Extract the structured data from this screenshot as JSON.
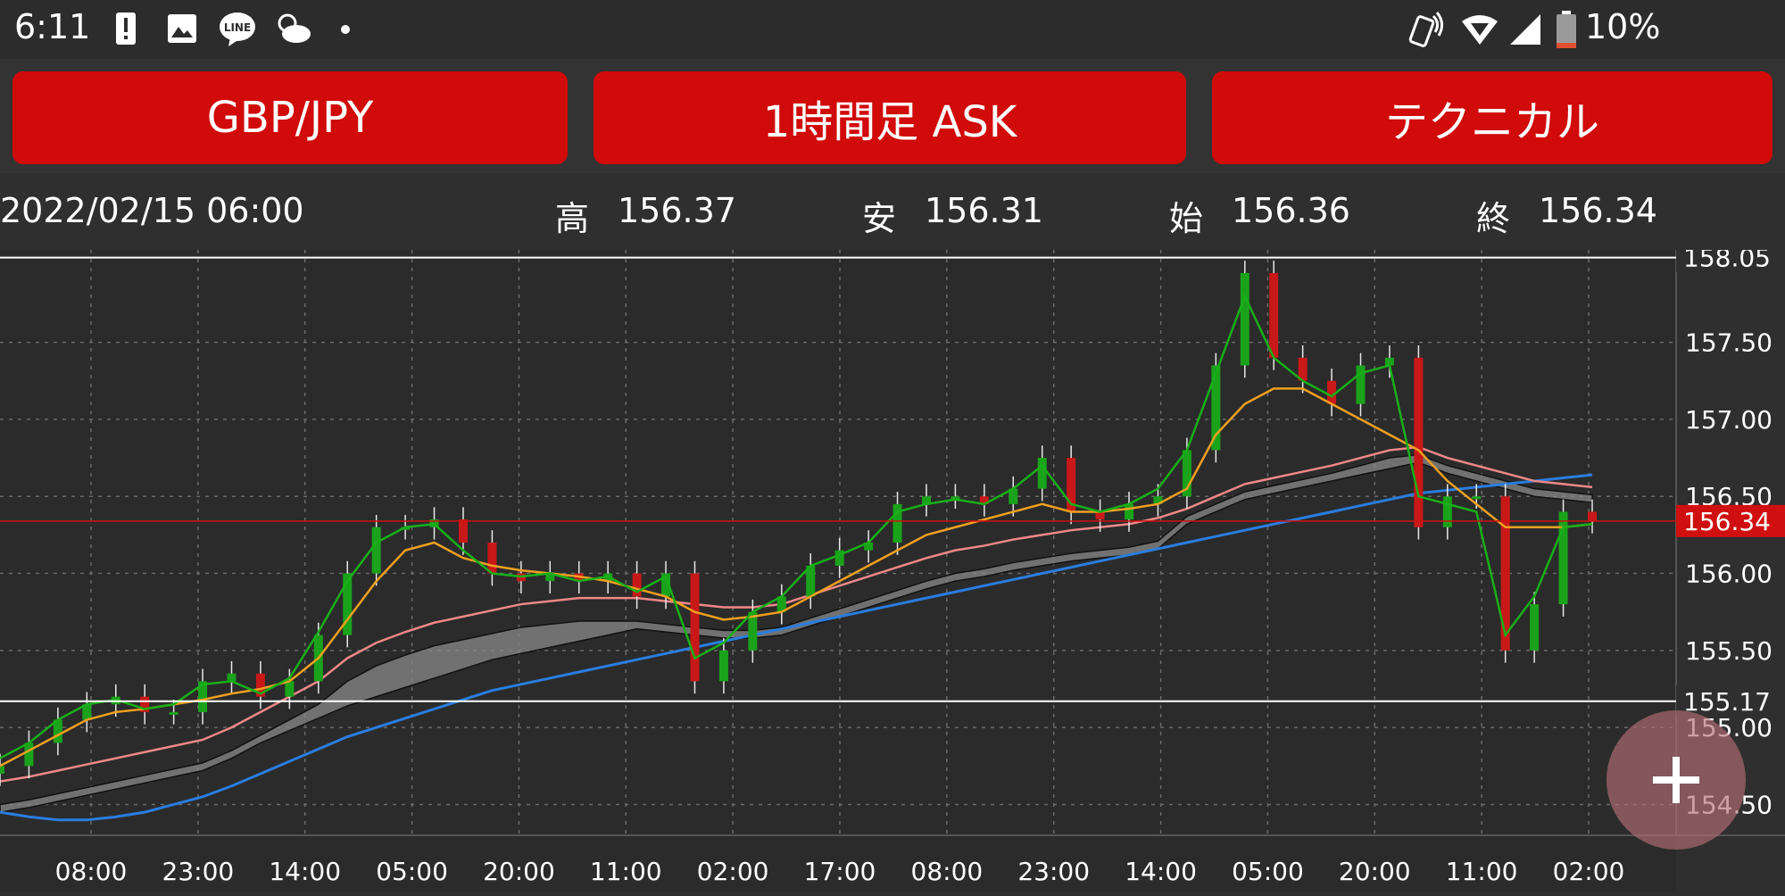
{
  "status_bar": {
    "time": "6:11",
    "battery": "10%",
    "icons": [
      "alert-icon",
      "image-icon",
      "line-app-icon",
      "weather-icon",
      "dot-icon",
      "phone-vibrate-icon",
      "wifi-icon",
      "signal-icon",
      "battery-icon"
    ],
    "line_label": "LINE"
  },
  "buttons": {
    "pair": "GBP/JPY",
    "timeframe": "1時間足 ASK",
    "technical": "テクニカル"
  },
  "info": {
    "datetime": "2022/02/15 06:00",
    "high_label": "高",
    "high": "156.37",
    "low_label": "安",
    "low": "156.31",
    "open_label": "始",
    "open": "156.36",
    "close_label": "終",
    "close": "156.34"
  },
  "colors": {
    "button_red": "#d10a0a",
    "up_candle": "#1aa31a",
    "down_candle": "#c81818",
    "ma_short": "#18b018",
    "ma_mid": "#f0a020",
    "ma_long": "#f08888",
    "ma_200": "#2a7de0",
    "kumo": "#8a8a8a",
    "price_line": "#d01010"
  },
  "chart_data": {
    "type": "line",
    "ylim": [
      154.3,
      158.1
    ],
    "y_ticks": [
      "154.50",
      "155.00",
      "155.50",
      "156.00",
      "156.50",
      "157.00",
      "157.50"
    ],
    "x_ticks": [
      "08:00",
      "23:00",
      "14:00",
      "05:00",
      "20:00",
      "11:00",
      "02:00",
      "17:00",
      "08:00",
      "23:00",
      "14:00",
      "05:00",
      "20:00",
      "11:00",
      "02:00"
    ],
    "high_marker": "158.05",
    "low_marker": "155.17",
    "current_price": "156.34",
    "series": [
      {
        "key": "close",
        "values": [
          154.75,
          154.9,
          155.05,
          155.15,
          155.2,
          155.1,
          155.1,
          155.3,
          155.35,
          155.2,
          155.3,
          155.6,
          156.0,
          156.3,
          156.3,
          156.35,
          156.2,
          156.0,
          155.95,
          156.0,
          155.95,
          156.0,
          155.85,
          156.0,
          155.3,
          155.5,
          155.75,
          155.85,
          156.05,
          156.15,
          156.2,
          156.45,
          156.5,
          156.5,
          156.45,
          156.55,
          156.75,
          156.4,
          156.35,
          156.45,
          156.5,
          156.8,
          157.35,
          157.95,
          157.4,
          157.25,
          157.1,
          157.35,
          157.4,
          156.3,
          156.5,
          156.5,
          155.5,
          155.8,
          156.4,
          156.34
        ]
      },
      {
        "key": "ma_short",
        "values": [
          154.8,
          154.9,
          155.05,
          155.15,
          155.18,
          155.12,
          155.15,
          155.28,
          155.3,
          155.22,
          155.32,
          155.62,
          155.95,
          156.2,
          156.3,
          156.32,
          156.15,
          156.0,
          155.98,
          156.0,
          155.95,
          155.98,
          155.88,
          155.98,
          155.45,
          155.55,
          155.75,
          155.85,
          156.05,
          156.12,
          156.2,
          156.4,
          156.45,
          156.48,
          156.45,
          156.55,
          156.7,
          156.45,
          156.4,
          156.45,
          156.55,
          156.8,
          157.3,
          157.8,
          157.4,
          157.25,
          157.15,
          157.3,
          157.35,
          156.5,
          156.45,
          156.4,
          155.6,
          155.85,
          156.3,
          156.32
        ]
      },
      {
        "key": "ma_mid",
        "values": [
          154.75,
          154.85,
          154.95,
          155.05,
          155.1,
          155.12,
          155.15,
          155.18,
          155.22,
          155.25,
          155.3,
          155.45,
          155.7,
          155.95,
          156.15,
          156.2,
          156.1,
          156.05,
          156.02,
          156.0,
          155.98,
          155.95,
          155.9,
          155.85,
          155.75,
          155.7,
          155.72,
          155.75,
          155.85,
          155.95,
          156.05,
          156.15,
          156.25,
          156.3,
          156.35,
          156.4,
          156.45,
          156.4,
          156.4,
          156.42,
          156.45,
          156.55,
          156.9,
          157.1,
          157.2,
          157.2,
          157.1,
          157.0,
          156.9,
          156.8,
          156.6,
          156.45,
          156.3,
          156.3,
          156.3,
          156.32
        ]
      },
      {
        "key": "ma_long",
        "values": [
          154.65,
          154.68,
          154.72,
          154.76,
          154.8,
          154.84,
          154.88,
          154.92,
          155.0,
          155.1,
          155.2,
          155.3,
          155.45,
          155.55,
          155.62,
          155.68,
          155.72,
          155.76,
          155.8,
          155.82,
          155.84,
          155.84,
          155.84,
          155.82,
          155.8,
          155.78,
          155.78,
          155.8,
          155.86,
          155.92,
          155.98,
          156.04,
          156.1,
          156.15,
          156.18,
          156.22,
          156.25,
          156.28,
          156.3,
          156.32,
          156.36,
          156.42,
          156.5,
          156.58,
          156.62,
          156.66,
          156.7,
          156.75,
          156.8,
          156.82,
          156.75,
          156.7,
          156.65,
          156.6,
          156.58,
          156.56
        ]
      },
      {
        "key": "ma_200",
        "values": [
          154.45,
          154.42,
          154.4,
          154.4,
          154.42,
          154.45,
          154.5,
          154.55,
          154.62,
          154.7,
          154.78,
          154.86,
          154.94,
          155.0,
          155.06,
          155.12,
          155.18,
          155.24,
          155.28,
          155.32,
          155.36,
          155.4,
          155.44,
          155.48,
          155.52,
          155.56,
          155.6,
          155.64,
          155.68,
          155.72,
          155.76,
          155.8,
          155.84,
          155.88,
          155.92,
          155.96,
          156.0,
          156.04,
          156.08,
          156.12,
          156.16,
          156.2,
          156.24,
          156.28,
          156.32,
          156.36,
          156.4,
          156.44,
          156.48,
          156.52,
          156.54,
          156.56,
          156.58,
          156.6,
          156.62,
          156.64
        ]
      }
    ]
  }
}
